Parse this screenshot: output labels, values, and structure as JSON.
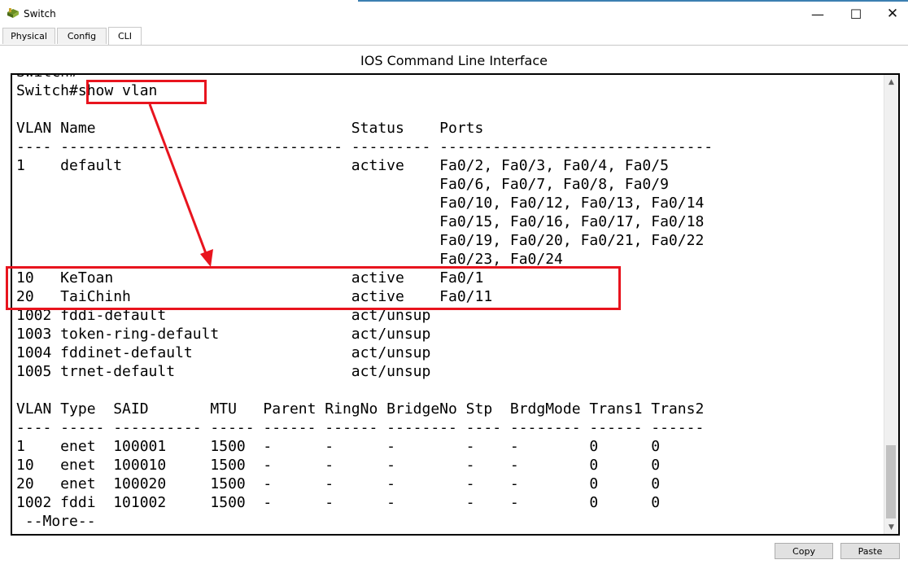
{
  "window": {
    "title": "Switch",
    "icon": "switch-icon",
    "controls": {
      "minimize": "—",
      "maximize": "☐",
      "close": "✕"
    }
  },
  "tabs": [
    {
      "label": "Physical",
      "active": false
    },
    {
      "label": "Config",
      "active": false
    },
    {
      "label": "CLI",
      "active": true
    }
  ],
  "panel": {
    "heading": "IOS Command Line Interface"
  },
  "terminal": {
    "lines": [
      "Switch#",
      "Switch#show vlan",
      "",
      "VLAN Name                             Status    Ports",
      "---- -------------------------------- --------- -------------------------------",
      "1    default                          active    Fa0/2, Fa0/3, Fa0/4, Fa0/5",
      "                                                Fa0/6, Fa0/7, Fa0/8, Fa0/9",
      "                                                Fa0/10, Fa0/12, Fa0/13, Fa0/14",
      "                                                Fa0/15, Fa0/16, Fa0/17, Fa0/18",
      "                                                Fa0/19, Fa0/20, Fa0/21, Fa0/22",
      "                                                Fa0/23, Fa0/24",
      "10   KeToan                           active    Fa0/1",
      "20   TaiChinh                         active    Fa0/11",
      "1002 fddi-default                     act/unsup",
      "1003 token-ring-default               act/unsup",
      "1004 fddinet-default                  act/unsup",
      "1005 trnet-default                    act/unsup",
      "",
      "VLAN Type  SAID       MTU   Parent RingNo BridgeNo Stp  BrdgMode Trans1 Trans2",
      "---- ----- ---------- ----- ------ ------ -------- ---- -------- ------ ------",
      "1    enet  100001     1500  -      -      -        -    -        0      0",
      "10   enet  100010     1500  -      -      -        -    -        0      0",
      "20   enet  100020     1500  -      -      -        -    -        0      0",
      "1002 fddi  101002     1500  -      -      -        -    -        0      0",
      " --More--"
    ]
  },
  "annotation": {
    "color": "#e8141e"
  },
  "buttons": {
    "copy": "Copy",
    "paste": "Paste"
  }
}
